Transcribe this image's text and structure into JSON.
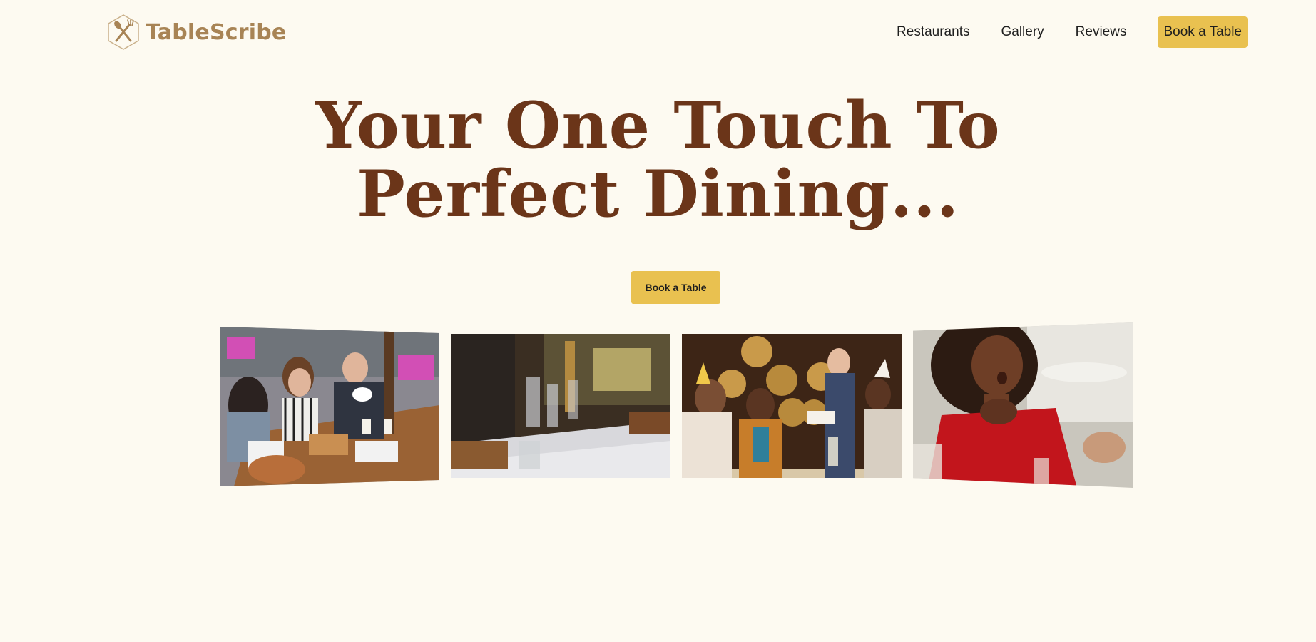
{
  "brand": {
    "name": "TableScribe",
    "icon": "fork-spoon-hexagon-icon",
    "color": "#a88455"
  },
  "nav": {
    "links": [
      {
        "label": "Restaurants"
      },
      {
        "label": "Gallery"
      },
      {
        "label": "Reviews"
      }
    ],
    "book_label": "Book a Table"
  },
  "hero": {
    "title_line1": "Your One Touch To",
    "title_line2": "Perfect Dining...",
    "cta_label": "Book a Table",
    "title_color": "#6b3519"
  },
  "gallery": {
    "photos": [
      {
        "subject": "friends-dining-outdoors-photo"
      },
      {
        "subject": "set-restaurant-table-photo"
      },
      {
        "subject": "birthday-celebration-photo"
      },
      {
        "subject": "surprised-woman-photo"
      }
    ]
  },
  "colors": {
    "background": "#fdfaf1",
    "accent": "#e9c150",
    "text": "#1e1e1e"
  }
}
